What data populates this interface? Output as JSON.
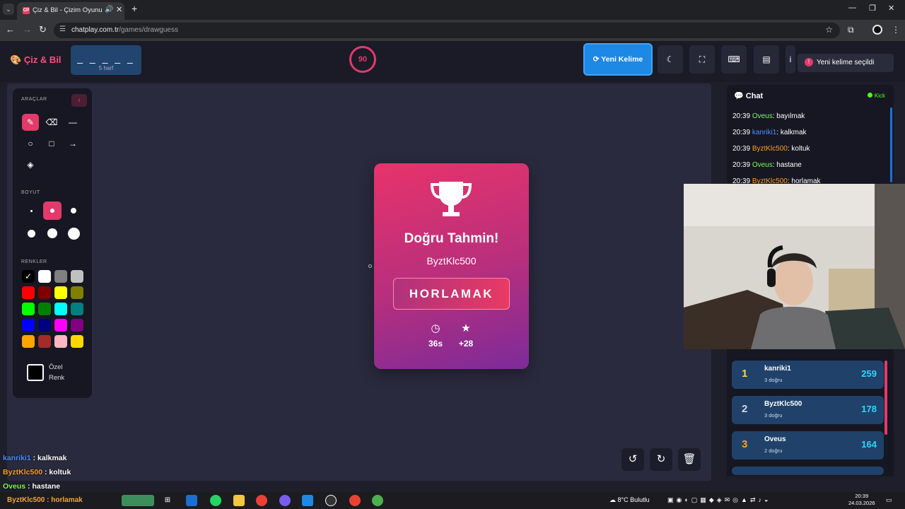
{
  "browser": {
    "tab_title": "Çiz & Bil - Çizim Oyunu",
    "favicon_text": "CP",
    "url_domain": "chatplay.com.tr",
    "url_path": "/games/drawguess"
  },
  "header": {
    "logo": "Çiz & Bil",
    "word_mask": "_ _ _ _ _",
    "word_length": "5 harf",
    "timer": "90",
    "new_word_label": "Yeni Kelime",
    "toast": "Yeni kelime seçildi"
  },
  "toolbox": {
    "tools_title": "ARAÇLAR",
    "size_title": "BOYUT",
    "colors_title": "RENKLER",
    "custom_color_label": "Özel Renk",
    "colors": [
      "#000000",
      "#ffffff",
      "#808080",
      "#c0c0c0",
      "#ff0000",
      "#800000",
      "#ffff00",
      "#808000",
      "#00ff00",
      "#008000",
      "#00ffff",
      "#008080",
      "#0000ff",
      "#000080",
      "#ff00ff",
      "#800080",
      "#ffa500",
      "#a52a2a",
      "#ffb6c1",
      "#ffd700"
    ],
    "selected_color": "#000000"
  },
  "result": {
    "title": "Doğru Tahmin!",
    "user": "ByztKlc500",
    "word": "HORLAMAK",
    "time": "36s",
    "points": "+28"
  },
  "chat": {
    "title": "Chat",
    "platform": "Kick",
    "messages": [
      {
        "time": "20:39",
        "user": "Oveus",
        "color": "#7cfc4f",
        "text": ": bayılmak"
      },
      {
        "time": "20:39",
        "user": "kanriki1",
        "color": "#4a90ff",
        "text": ": kalkmak"
      },
      {
        "time": "20:39",
        "user": "ByztKlc500",
        "color": "#ff9f1a",
        "text": ": koltuk"
      },
      {
        "time": "20:39",
        "user": "Oveus",
        "color": "#7cfc4f",
        "text": ": hastane"
      },
      {
        "time": "20:39",
        "user": "ByztKlc500",
        "color": "#ff9f1a",
        "text": ": horlamak"
      }
    ]
  },
  "leaderboard": [
    {
      "rank": "1",
      "name": "kanriki1",
      "sub": "3 doğru",
      "score": "259",
      "rank_color": "#ffd54a"
    },
    {
      "rank": "2",
      "name": "ByztKlc500",
      "sub": "3 doğru",
      "score": "178",
      "rank_color": "#cfd8e3"
    },
    {
      "rank": "3",
      "name": "Oveus",
      "sub": "2 doğru",
      "score": "164",
      "rank_color": "#ff9f1a"
    }
  ],
  "stream_overlay": [
    {
      "user": "kanriki1",
      "color": "#4a90ff",
      "text": " : kalkmak"
    },
    {
      "user": "ByztKlc500",
      "color": "#ff9f1a",
      "text": " : koltuk"
    },
    {
      "user": "Oveus",
      "color": "#7cfc4f",
      "text": " : hastane"
    }
  ],
  "taskbar": {
    "weather": "8°C Bulutlu",
    "time": "20:39",
    "date": "24.03.2026",
    "search_hint": "horlamak"
  }
}
